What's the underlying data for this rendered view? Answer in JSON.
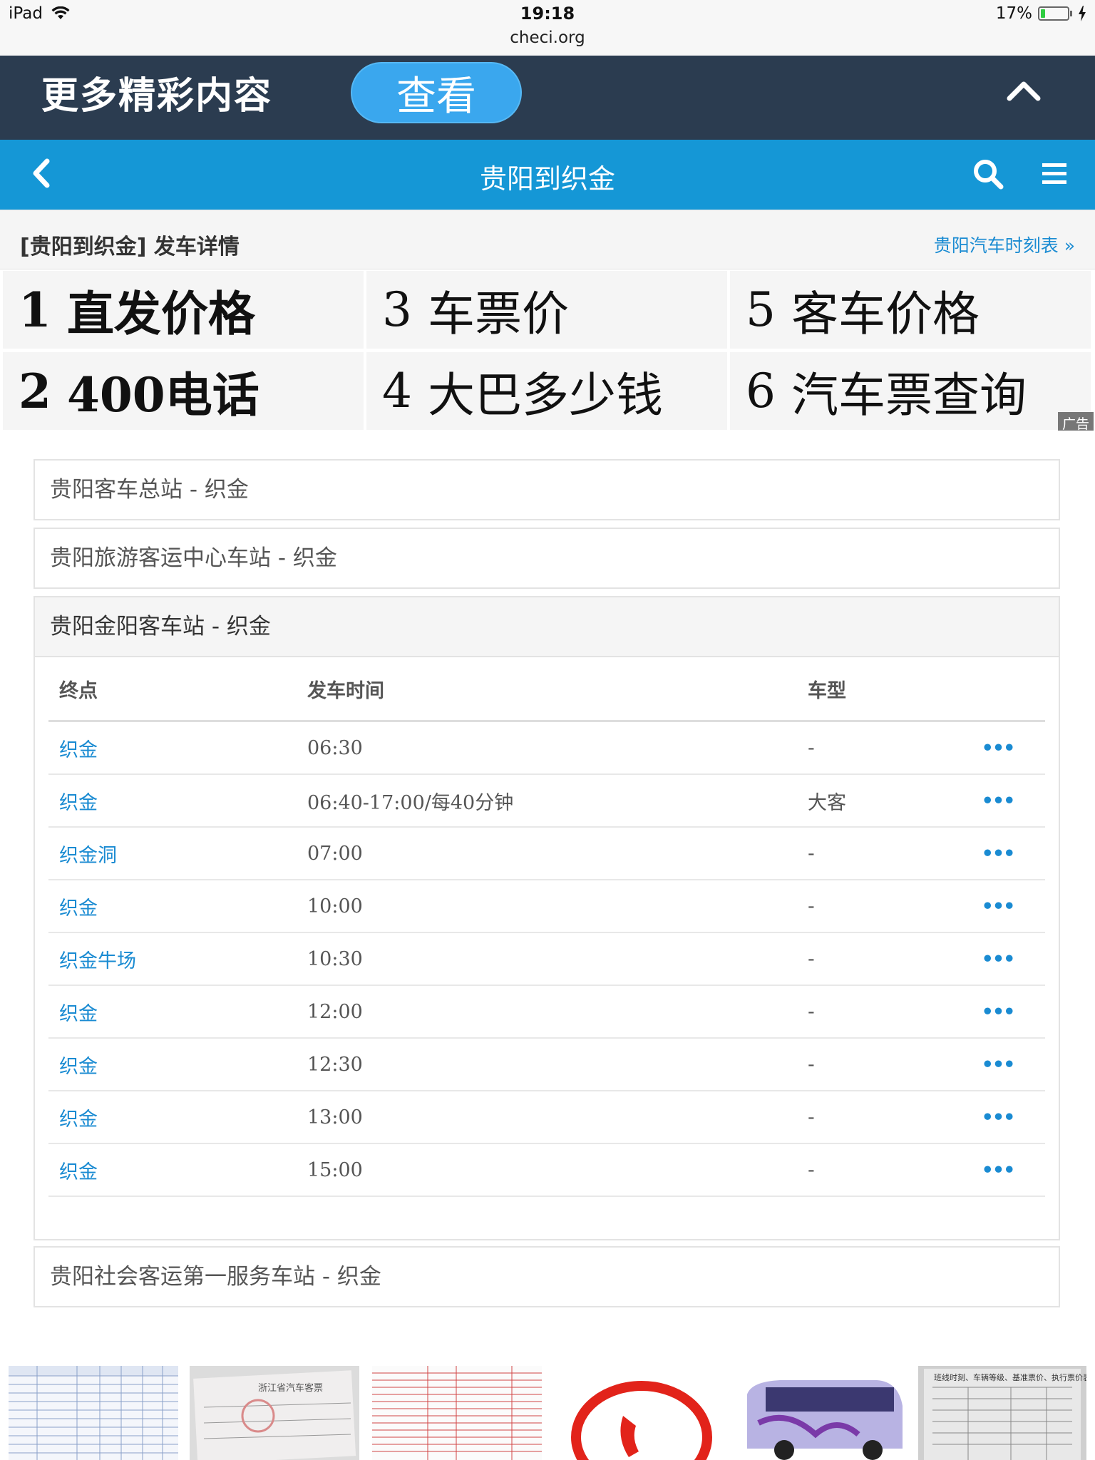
{
  "status_bar": {
    "device": "iPad",
    "time": "19:18",
    "url": "checi.org",
    "battery": "17%",
    "battery_level": 0.17
  },
  "promo": {
    "text": "更多精彩内容",
    "button_label": "查看"
  },
  "nav": {
    "title": "贵阳到织金"
  },
  "section": {
    "title": "[贵阳到织金] 发车详情",
    "link": "贵阳汽车时刻表 »"
  },
  "ads": {
    "items": [
      {
        "num": "1",
        "label": "直发价格"
      },
      {
        "num": "2",
        "label": "400电话"
      },
      {
        "num": "3",
        "label": "车票价"
      },
      {
        "num": "4",
        "label": "大巴多少钱"
      },
      {
        "num": "5",
        "label": "客车价格"
      },
      {
        "num": "6",
        "label": "汽车票查询"
      }
    ],
    "tag": "广告"
  },
  "stations": [
    {
      "name": "贵阳客车总站 - 织金"
    },
    {
      "name": "贵阳旅游客运中心车站 - 织金"
    },
    {
      "name": "贵阳金阳客车站 - 织金"
    },
    {
      "name": "贵阳社会客运第一服务车站 - 织金"
    }
  ],
  "schedule": {
    "headers": {
      "dest": "终点",
      "time": "发车时间",
      "type": "车型"
    },
    "rows": [
      {
        "dest": "织金",
        "time": "06:30",
        "type": "-",
        "more": "•••"
      },
      {
        "dest": "织金",
        "time": "06:40-17:00/每40分钟",
        "type": "大客",
        "more": "•••"
      },
      {
        "dest": "织金洞",
        "time": "07:00",
        "type": "-",
        "more": "•••"
      },
      {
        "dest": "织金",
        "time": "10:00",
        "type": "-",
        "more": "•••"
      },
      {
        "dest": "织金牛场",
        "time": "10:30",
        "type": "-",
        "more": "•••"
      },
      {
        "dest": "织金",
        "time": "12:00",
        "type": "-",
        "more": "•••"
      },
      {
        "dest": "织金",
        "time": "12:30",
        "type": "-",
        "more": "•••"
      },
      {
        "dest": "织金",
        "time": "13:00",
        "type": "-",
        "more": "•••"
      },
      {
        "dest": "织金",
        "time": "15:00",
        "type": "-",
        "more": "•••"
      }
    ]
  },
  "thumbnails": [
    {
      "name": "airport-code-table-image"
    },
    {
      "name": "bus-ticket-image",
      "title": "浙江省汽车客票"
    },
    {
      "name": "fare-list-image"
    },
    {
      "name": "phone-logo-image"
    },
    {
      "name": "tour-bus-image"
    },
    {
      "name": "fare-notice-image",
      "title": "班线时刻、车辆等级、基准票价、执行票价表"
    }
  ]
}
